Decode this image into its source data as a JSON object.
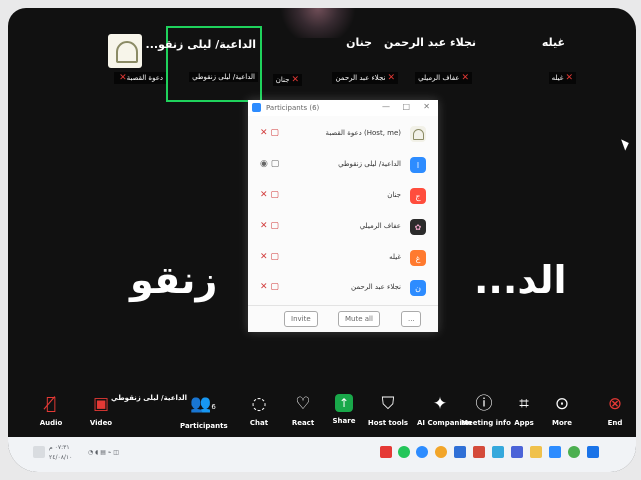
{
  "top_tiles": [
    {
      "name": "غيله",
      "label": "غيله"
    },
    {
      "name": "نجلاء عبد الرحمن",
      "label": "عفاف الرميلي"
    },
    {
      "name": "جنان",
      "label": "نجلاء عبد الرحمن"
    },
    {
      "name": "...الداعية/ ليلى زنقو",
      "label": "جنان"
    },
    {
      "name": "",
      "label": "الداعية/ ليلى زنقوطي"
    },
    {
      "name": "",
      "label": "دعوة القصبة"
    }
  ],
  "participants_panel": {
    "title": "Participants (6)",
    "rows": [
      {
        "name": "دعوة القصبة (Host, me)",
        "avatar_text": "",
        "avatar_color": "#f2f1e8"
      },
      {
        "name": "الداعية/ ليلى زنقوطي",
        "avatar_text": "ا",
        "avatar_color": "#2d8cff"
      },
      {
        "name": "جنان",
        "avatar_text": "ج",
        "avatar_color": "#ff4d3d"
      },
      {
        "name": "عفاف الرميلي",
        "avatar_text": "",
        "avatar_color": "#2b2b2b"
      },
      {
        "name": "غيله",
        "avatar_text": "غ",
        "avatar_color": "#ff7a2f"
      },
      {
        "name": "نجلاء عبد الرحمن",
        "avatar_text": "ن",
        "avatar_color": "#2d8cff"
      }
    ],
    "invite_label": "Invite",
    "mute_all_label": "Mute all",
    "more_label": "..."
  },
  "speaker_caption": "الداعية/ ليلى زنقوطي",
  "center_name_left": "زنقو",
  "center_name_right": "...الد",
  "toolbar": {
    "audio": "Audio",
    "video": "Video",
    "participants": "Participants",
    "participants_count": "6",
    "chat": "Chat",
    "react": "React",
    "share": "Share",
    "host_tools": "Host tools",
    "ai_companion": "AI Companion",
    "meeting_info": "Meeting info",
    "apps": "Apps",
    "more": "More",
    "end": "End"
  },
  "system_tray": {
    "time": "٠٧:٣١ م",
    "date": "٢٤/٠٨/١٠"
  },
  "colors": {
    "zoom_blue": "#2d8cff",
    "mute_red": "#e53935",
    "active_green": "#1fd25c",
    "share_green": "#19a84a"
  }
}
